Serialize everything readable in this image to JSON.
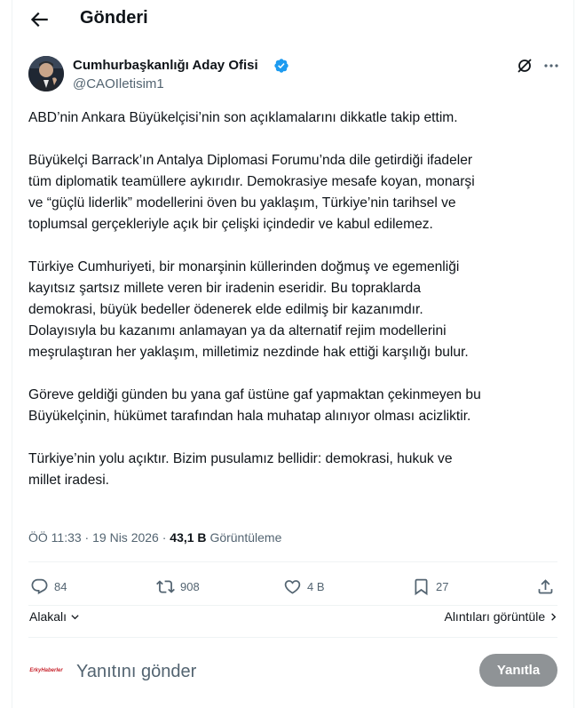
{
  "header": {
    "title": "Gönderi",
    "back_icon": "arrow-left-icon"
  },
  "author": {
    "name": "Cumhurbaşkanlığı Aday Ofisi",
    "handle": "@CAOIletisim1",
    "verified": true,
    "badge_color": "#1d9bf0"
  },
  "tweet": {
    "paragraphs": [
      [
        "ABD’nin Ankara Büyükelçisi’nin son açıklamalarını dikkatle takip ettim."
      ],
      [
        "Büyükelçi Barrack’ın Antalya Diplomasi Forumu’nda dile getirdiği ifadeler",
        "tüm diplomatik teamüllere aykırıdır. Demokrasiye mesafe koyan, monarşi",
        "ve “güçlü liderlik” modellerini öven bu yaklaşım, Türkiye’nin tarihsel ve",
        "toplumsal gerçekleriyle açık bir çelişki içindedir ve kabul edilemez."
      ],
      [
        "Türkiye Cumhuriyeti, bir monarşinin küllerinden doğmuş ve egemenliği",
        "kayıtsız şartsız millete veren bir iradenin eseridir. Bu topraklarda",
        "demokrasi, büyük bedeller ödenerek elde edilmiş bir kazanımdır.",
        "Dolayısıyla bu kazanımı anlamayan ya da alternatif rejim modellerini",
        "meşrulaştıran her yaklaşım, milletimiz nezdinde hak ettiği karşılığı bulur."
      ],
      [
        "Göreve geldiği günden bu yana gaf üstüne gaf yapmaktan çekinmeyen bu",
        "Büyükelçinin, hükümet tarafından hala muhatap alınıyor olması acizliktir."
      ],
      [
        "Türkiye’nin yolu açıktır. Bizim pusulamız bellidir: demokrasi, hukuk ve",
        "millet iradesi."
      ]
    ]
  },
  "meta": {
    "time": "ÖÖ 11:33",
    "separator": " · ",
    "date": "19 Nis 2026",
    "views": "43,1 B",
    "views_label": "Görüntüleme"
  },
  "actions": {
    "replies": "84",
    "reposts": "908",
    "likes": "4 B",
    "bookmarks": "27"
  },
  "relevance": {
    "label": "Alakalı",
    "quotes_label": "Alıntıları görüntüle"
  },
  "reply": {
    "avatar_text": "ErkyHaberler",
    "placeholder": "Yanıtını gönder",
    "button_label": "Yanıtla"
  }
}
